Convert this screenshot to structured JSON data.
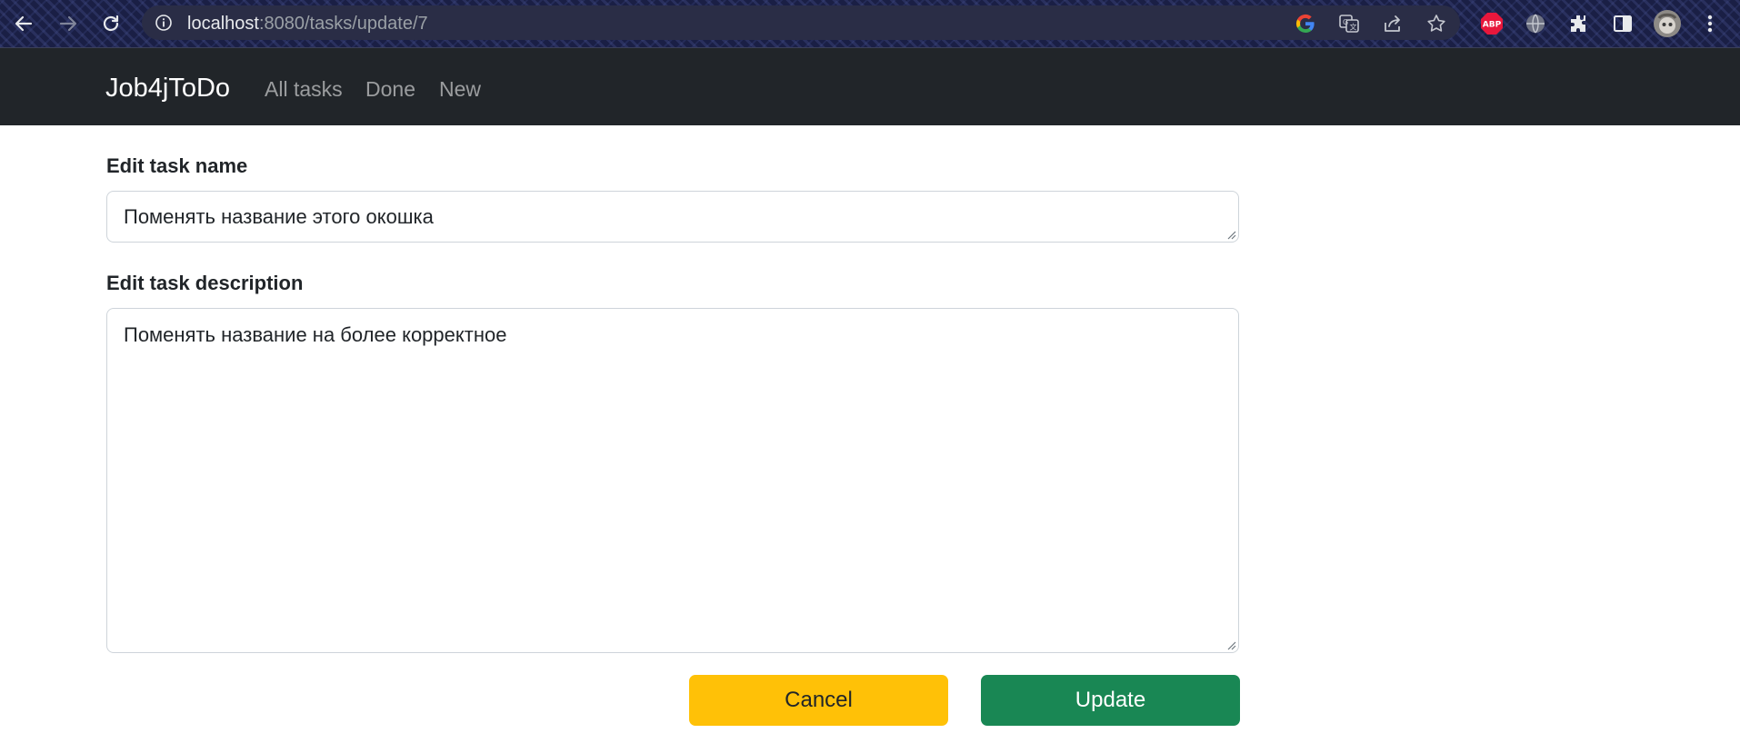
{
  "browser": {
    "url_host": "localhost",
    "url_path": ":8080/tasks/update/7",
    "icons": {
      "back": "arrow-left-icon",
      "forward": "arrow-right-icon",
      "reload": "reload-icon",
      "info": "info-icon",
      "google": "google-icon",
      "translate": "translate-icon",
      "share": "share-icon",
      "bookmark": "star-icon",
      "adblock": "abp-icon",
      "extension_globe": "globe-icon",
      "extensions": "puzzle-icon",
      "side_panel": "side-panel-icon",
      "profile": "avatar",
      "menu": "kebab-menu-icon"
    },
    "adblock_label": "ABP"
  },
  "navbar": {
    "brand": "Job4jToDo",
    "links": [
      "All tasks",
      "Done",
      "New"
    ]
  },
  "form": {
    "name_label": "Edit task name",
    "name_value": "Поменять название этого окошка",
    "description_label": "Edit task description",
    "description_value": "Поменять название на более корректное",
    "cancel_label": "Cancel",
    "update_label": "Update"
  },
  "colors": {
    "navbar_bg": "#212529",
    "cancel_bg": "#ffc107",
    "update_bg": "#198754",
    "abp_red": "#e8173c"
  }
}
